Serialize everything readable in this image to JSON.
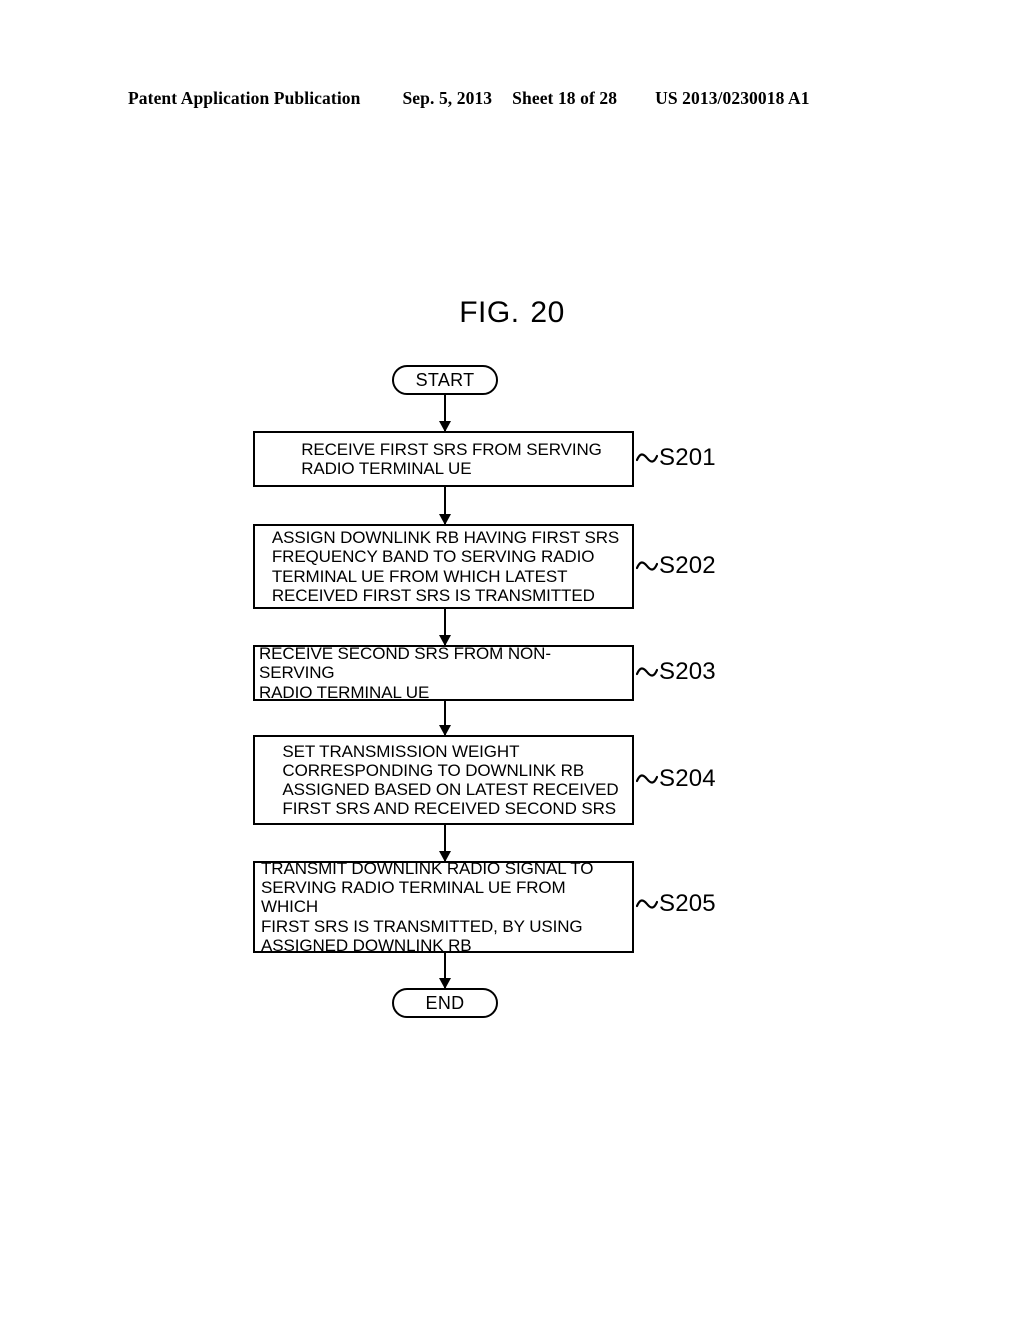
{
  "header": {
    "publication": "Patent Application Publication",
    "date": "Sep. 5, 2013",
    "sheet": "Sheet 18 of 28",
    "patent_number": "US 2013/0230018 A1"
  },
  "figure": {
    "label": "FIG.",
    "number": "20"
  },
  "flowchart": {
    "start_label": "START",
    "end_label": "END",
    "steps": [
      {
        "id": "S201",
        "text": "RECEIVE FIRST SRS FROM SERVING\nRADIO TERMINAL UE"
      },
      {
        "id": "S202",
        "text": "ASSIGN DOWNLINK RB HAVING FIRST SRS\nFREQUENCY BAND TO SERVING RADIO\nTERMINAL UE FROM WHICH LATEST\nRECEIVED FIRST SRS IS TRANSMITTED"
      },
      {
        "id": "S203",
        "text": "RECEIVE SECOND SRS FROM NON-SERVING\nRADIO TERMINAL UE"
      },
      {
        "id": "S204",
        "text": "SET TRANSMISSION WEIGHT\nCORRESPONDING TO DOWNLINK RB\nASSIGNED BASED ON LATEST RECEIVED\nFIRST SRS AND RECEIVED SECOND SRS"
      },
      {
        "id": "S205",
        "text": "TRANSMIT DOWNLINK RADIO SIGNAL TO\nSERVING RADIO TERMINAL UE FROM WHICH\nFIRST SRS IS TRANSMITTED, BY USING\nASSIGNED DOWNLINK RB"
      }
    ]
  },
  "colors": {
    "ink": "#000000",
    "paper": "#ffffff"
  }
}
